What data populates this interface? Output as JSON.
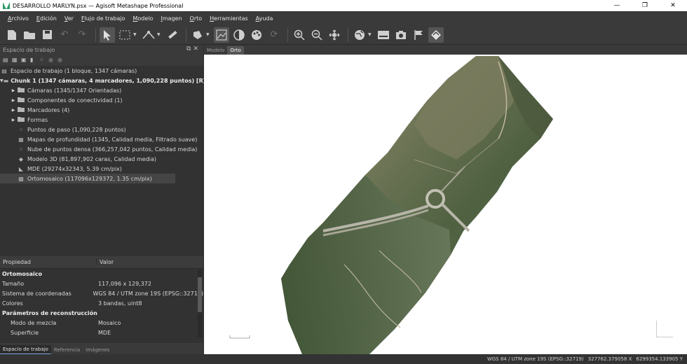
{
  "window": {
    "title": "DESARROLLO MARLYN.psx — Agisoft Metashape Professional",
    "controls": [
      "—",
      "❐",
      "✕"
    ]
  },
  "menu": [
    "Archivo",
    "Edición",
    "Ver",
    "Flujo de trabajo",
    "Modelo",
    "Imagen",
    "Orto",
    "Herramientas",
    "Ayuda"
  ],
  "workspace": {
    "panel_title": "Espacio de trabajo",
    "root": "Espacio de trabajo (1 bloque, 1347 cámaras)",
    "chunk": "Chunk 1 (1347 cámaras, 4 marcadores, 1,090,228 puntos) [R]",
    "items": [
      {
        "label": "Cámaras (1345/1347 Orientadas)",
        "icon": "folder-icon",
        "expandable": true
      },
      {
        "label": "Componentes de conectividad (1)",
        "icon": "folder-icon",
        "expandable": true
      },
      {
        "label": "Marcadores (4)",
        "icon": "folder-icon",
        "expandable": true
      },
      {
        "label": "Formas",
        "icon": "folder-icon",
        "expandable": true
      },
      {
        "label": "Puntos de paso (1,090,228 puntos)",
        "icon": "tie-points-icon",
        "expandable": false
      },
      {
        "label": "Mapas de profundidad (1345, Calidad media, Filtrado suave)",
        "icon": "depth-maps-icon",
        "expandable": false
      },
      {
        "label": "Nube de puntos densa (366,257,042 puntos, Calidad media)",
        "icon": "dense-cloud-icon",
        "expandable": false
      },
      {
        "label": "Modelo 3D (81,897,902 caras, Calidad media)",
        "icon": "model-icon",
        "expandable": false
      },
      {
        "label": "MDE (29274x32343, 5.39 cm/pix)",
        "icon": "dem-icon",
        "expandable": false
      },
      {
        "label": "Ortomosaico (117096x129372, 1.35 cm/pix)",
        "icon": "orthomosaic-icon",
        "expandable": false
      }
    ]
  },
  "properties": {
    "col_property": "Propiedad",
    "col_value": "Valor",
    "rows": [
      {
        "key": "Ortomosaico",
        "value": "",
        "group": true,
        "sub": false
      },
      {
        "key": "Tamaño",
        "value": "117,096 x 129,372",
        "group": false,
        "sub": false
      },
      {
        "key": "Sistema de coordenadas",
        "value": "WGS 84 / UTM zone 19S (EPSG::32719)",
        "group": false,
        "sub": false
      },
      {
        "key": "Colores",
        "value": "3 bandas, uint8",
        "group": false,
        "sub": false
      },
      {
        "key": "Parámetros de reconstrucción",
        "value": "",
        "group": true,
        "sub": false
      },
      {
        "key": "Modo de mezcla",
        "value": "Mosaico",
        "group": false,
        "sub": true
      },
      {
        "key": "Superficie",
        "value": "MDE",
        "group": false,
        "sub": true
      }
    ]
  },
  "bottom_tabs": [
    "Espacio de trabajo",
    "Referencia",
    "Imágenes"
  ],
  "view_tabs": [
    "Modelo",
    "Orto"
  ],
  "status": {
    "crs": "WGS 84 / UTM zone 19S (EPSG::32719)",
    "x": "327762.379058 X",
    "y": "6299354.133905 Y"
  },
  "colors": {
    "accent": "#7aa6d6",
    "panel": "#3a3a3a"
  }
}
